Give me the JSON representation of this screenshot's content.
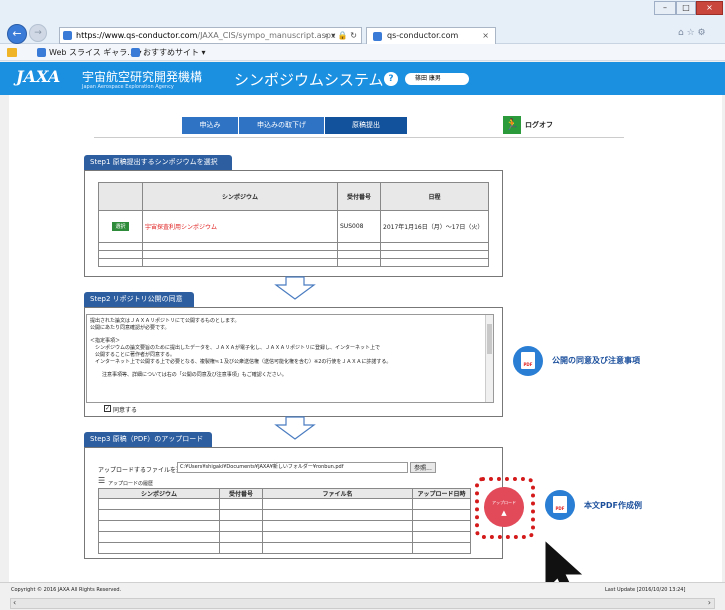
{
  "browser": {
    "url_domain": "https://www.qs-conductor.com",
    "url_path": "/JAXA_CIS/sympo_manuscript.aspx",
    "addr_icons": "⌕ ▾ 🔒 ↻",
    "tab_title": "qs-conductor.com",
    "tab_close": "×",
    "fav_slice": "Web スライス ギャラ... ▾",
    "fav_sites": "おすすめサイト ▾",
    "back_glyph": "←",
    "fwd_glyph": "→",
    "home_glyphs": "⌂ ☆ ⚙",
    "win_min": "–",
    "win_max": "□",
    "win_close": "×"
  },
  "header": {
    "logo": "JAXA",
    "org_jp": "宇宙航空研究開発機構",
    "org_en": "Japan Aerospace Exploration Agency",
    "system_title": "シンポジウムシステム",
    "help": "?",
    "user_name": "篠田 康男"
  },
  "nav": {
    "tabs": [
      "申込み",
      "申込みの取下げ",
      "原稿提出"
    ],
    "logoff": "ログオフ"
  },
  "step1": {
    "title": "Step1 原稿提出するシンポジウムを選択",
    "headers": [
      "シンポジウム",
      "受付番号",
      "日程"
    ],
    "select_label": "選択",
    "row_name": "宇宙探査利用シンポジウム",
    "row_id": "SUS008",
    "row_date": "2017年1月16日（月）～17日（火）"
  },
  "step2": {
    "title": "Step2 リポジトリ公開の同意",
    "line1": "提出された論文はＪＡＸＡリポジトリにて公開するものとします。",
    "line2": "公開にあたり同意確認が必要です。",
    "line3": "＜指定事項＞",
    "line4": "シンポジウムの論文要旨のために提出したデータを、ＪＡＸＡが電子化し、ＪＡＸＡリポジトリに登録し、インターネット上で",
    "line5": "公開することに著作者が同意する。",
    "line6": "インターネット上で公開する上で必要となる、複製権≒１及び公衆送信権（送信可能化権を含む）※2の行使をＪＡＸＡに許諾する。",
    "line7": "注意事項等、詳細については右の「公開の同意及び注意事項」もご確認ください。",
    "agree_label": "同意する",
    "pdf_link": "公開の同意及び注意事項"
  },
  "step3": {
    "title": "Step3 原稿（PDF）のアップロード",
    "file_label": "アップロードするファイルを選択",
    "file_path": "C:¥Users¥shigaki¥Documents¥JAXA¥新しいフォルダー¥ronbun.pdf",
    "browse": "参照...",
    "history_label": "アップロードの履歴",
    "headers": [
      "シンポジウム",
      "受付番号",
      "ファイル名",
      "アップロード日時"
    ],
    "upload_btn": "アップロード",
    "pdf_link": "本文PDF作成例"
  },
  "pdf_badge": "PDF",
  "footer": {
    "copyright": "Copyright © 2016 JAXA All Rights Reserved.",
    "last_update": "Last Update [2016/10/20 13:24]"
  },
  "colors": {
    "header_blue": "#1b8fe0",
    "step_title": "#2d5ea0",
    "upload_red": "#e24a5a",
    "pdf_icon": "#2a7fd4"
  }
}
